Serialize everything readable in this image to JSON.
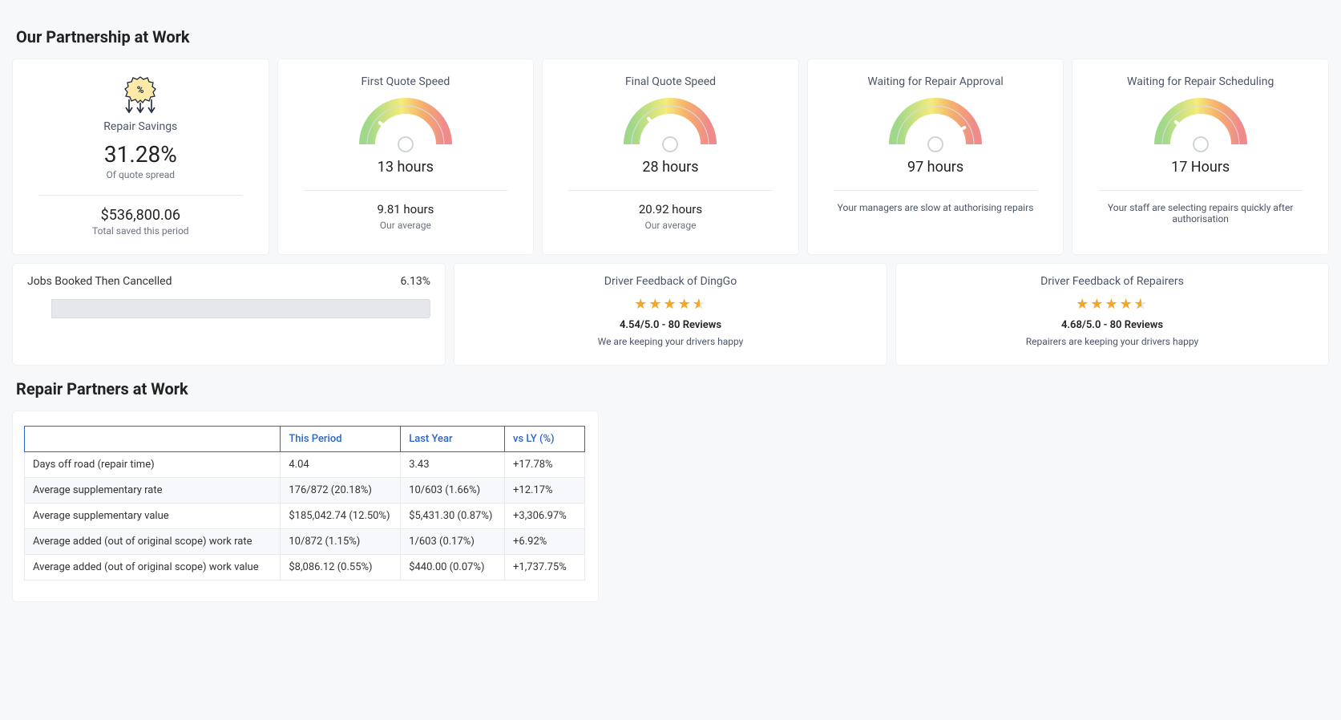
{
  "sections": {
    "partnership_title": "Our Partnership at Work",
    "partners_title": "Repair Partners at Work"
  },
  "savings": {
    "title": "Repair Savings",
    "pct": "31.28%",
    "pct_label": "Of quote spread",
    "amount": "$536,800.06",
    "amount_label": "Total saved this period"
  },
  "gauges": [
    {
      "title": "First Quote Speed",
      "value": "13 hours",
      "sub_value": "9.81 hours",
      "sub_label": "Our average",
      "needle": 40,
      "type": "avg"
    },
    {
      "title": "Final Quote Speed",
      "value": "28 hours",
      "sub_value": "20.92 hours",
      "sub_label": "Our average",
      "needle": 50,
      "type": "avg"
    },
    {
      "title": "Waiting for Repair Approval",
      "value": "97 hours",
      "msg": "Your managers are slow at authorising repairs",
      "needle": 150,
      "type": "msg"
    },
    {
      "title": "Waiting for Repair Scheduling",
      "value": "17 Hours",
      "msg": "Your staff are selecting repairs quickly after authorisation",
      "needle": 42,
      "type": "msg"
    }
  ],
  "jobs_cancelled": {
    "title": "Jobs Booked Then Cancelled",
    "pct": "6.13%",
    "fill_pct": 6.13
  },
  "feedback": [
    {
      "title": "Driver Feedback of DingGo",
      "score": "4.54/5.0 - 80 Reviews",
      "msg": "We are keeping your drivers happy",
      "stars": 4.5
    },
    {
      "title": "Driver Feedback of Repairers",
      "score": "4.68/5.0 - 80 Reviews",
      "msg": "Repairers are keeping your drivers happy",
      "stars": 4.5
    }
  ],
  "table": {
    "headers": [
      "",
      "This Period",
      "Last Year",
      "vs LY (%)"
    ],
    "rows": [
      [
        "Days off road (repair time)",
        "4.04",
        "3.43",
        "+17.78%"
      ],
      [
        "Average supplementary rate",
        "176/872 (20.18%)",
        "10/603 (1.66%)",
        "+12.17%"
      ],
      [
        "Average supplementary value",
        "$185,042.74 (12.50%)",
        "$5,431.30 (0.87%)",
        "+3,306.97%"
      ],
      [
        "Average added (out of original scope) work rate",
        "10/872 (1.15%)",
        "1/603 (0.17%)",
        "+6.92%"
      ],
      [
        "Average added (out of original scope) work value",
        "$8,086.12 (0.55%)",
        "$440.00 (0.07%)",
        "+1,737.75%"
      ]
    ]
  },
  "chart_data": [
    {
      "type": "gauge",
      "title": "First Quote Speed",
      "value": 13,
      "unit": "hours",
      "range": [
        0,
        180
      ],
      "average": 9.81
    },
    {
      "type": "gauge",
      "title": "Final Quote Speed",
      "value": 28,
      "unit": "hours",
      "range": [
        0,
        180
      ],
      "average": 20.92
    },
    {
      "type": "gauge",
      "title": "Waiting for Repair Approval",
      "value": 97,
      "unit": "hours",
      "range": [
        0,
        180
      ]
    },
    {
      "type": "gauge",
      "title": "Waiting for Repair Scheduling",
      "value": 17,
      "unit": "hours",
      "range": [
        0,
        180
      ]
    },
    {
      "type": "bar",
      "title": "Jobs Booked Then Cancelled",
      "values": [
        6.13
      ],
      "unit": "%",
      "xlim": [
        0,
        100
      ]
    }
  ]
}
